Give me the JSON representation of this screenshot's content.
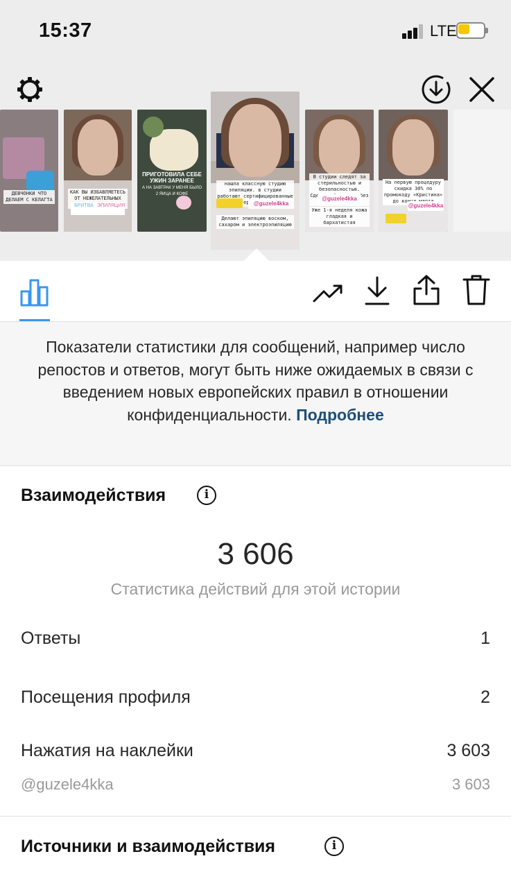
{
  "status_bar": {
    "time": "15:37",
    "network": "LTE",
    "battery_level": 0.45,
    "battery_color": "#f5c800"
  },
  "top_bar": {
    "settings_icon": "gear-icon",
    "download_icon": "download-circle-icon",
    "close_icon": "close-icon"
  },
  "stories": [
    {
      "caption": "ДЕВЧОНКИ ЧТО ДЕЛАЕМ С КЕЛАГТА"
    },
    {
      "caption": "КАК ВЫ ИЗБАВЛЯЕТЕСЬ ОТ НЕЖЕЛАТЕЛЬНЫХ ВОЛОС?",
      "options": [
        "БРИТВА",
        "ЭПИЛЯЦИЯ"
      ]
    },
    {
      "caption": "ПРИГОТОВИЛА СЕБЕ УЖИН ЗАРАНЕЕ",
      "sub": "А НА ЗАВТРАК У МЕНЯ БЫЛО 2 ЯИЦА И КОФЕ"
    },
    {
      "caption": "нашла классную студию эпиляции. в студии работают сертифицированные мастера с опытом",
      "handle": "@guzele4kka",
      "sub": "Делают эпиляцию воском, сахаром и электроэпиляцию",
      "selected": true
    },
    {
      "caption": "В студии следят за стерильностью и безопасностью. Сделали быстро и без боли",
      "handle": "@guzele4kka",
      "sub": "Уже 1-я неделя кожа гладкая и бархатистая"
    },
    {
      "caption": "На первую процедуру скидка 30% по промокоду «Кристина» до конца марта",
      "handle": "@guzele4kka"
    }
  ],
  "toolbar": {
    "insights_icon": "bar-chart-icon",
    "promote_icon": "trending-up-icon",
    "save_icon": "download-icon",
    "share_icon": "share-icon",
    "delete_icon": "trash-icon"
  },
  "notice": {
    "text": "Показатели статистики для сообщений, например число репостов и ответов, могут быть ниже ожидаемых в связи с введением новых европейских правил в отношении конфиденциальности.",
    "link": "Подробнее"
  },
  "interactions": {
    "title": "Взаимодействия",
    "total": "3 606",
    "subtitle": "Статистика действий для этой истории",
    "rows": [
      {
        "label": "Ответы",
        "value": "1"
      },
      {
        "label": "Посещения профиля",
        "value": "2"
      },
      {
        "label": "Нажатия на наклейки",
        "value": "3 603"
      }
    ],
    "sticker": {
      "label": "@guzele4kka",
      "value": "3 603"
    }
  },
  "sources": {
    "title": "Источники и взаимодействия"
  },
  "colors": {
    "accent": "#3897f0",
    "link": "#1d4f7a",
    "muted": "#999999"
  }
}
